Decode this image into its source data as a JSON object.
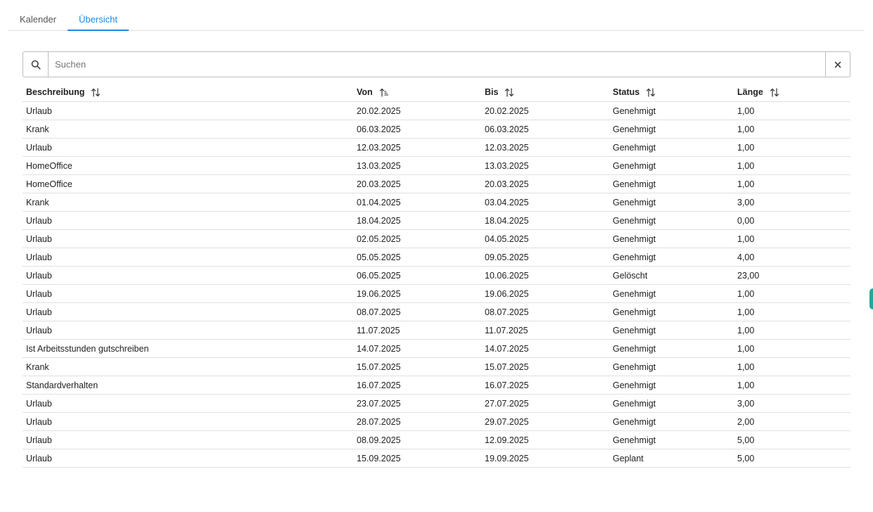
{
  "tabs": [
    {
      "label": "Kalender",
      "active": false
    },
    {
      "label": "Übersicht",
      "active": true
    }
  ],
  "search": {
    "placeholder": "Suchen",
    "value": "",
    "search_icon": "search-icon",
    "clear_icon": "close-icon"
  },
  "table": {
    "columns": [
      {
        "key": "beschreibung",
        "label": "Beschreibung",
        "sort": "none"
      },
      {
        "key": "von",
        "label": "Von",
        "sort": "ascending"
      },
      {
        "key": "bis",
        "label": "Bis",
        "sort": "none"
      },
      {
        "key": "status",
        "label": "Status",
        "sort": "none"
      },
      {
        "key": "laenge",
        "label": "Länge",
        "sort": "none"
      }
    ],
    "rows": [
      {
        "beschreibung": "Urlaub",
        "von": "20.02.2025",
        "bis": "20.02.2025",
        "status": "Genehmigt",
        "laenge": "1,00"
      },
      {
        "beschreibung": "Krank",
        "von": "06.03.2025",
        "bis": "06.03.2025",
        "status": "Genehmigt",
        "laenge": "1,00"
      },
      {
        "beschreibung": "Urlaub",
        "von": "12.03.2025",
        "bis": "12.03.2025",
        "status": "Genehmigt",
        "laenge": "1,00"
      },
      {
        "beschreibung": "HomeOffice",
        "von": "13.03.2025",
        "bis": "13.03.2025",
        "status": "Genehmigt",
        "laenge": "1,00"
      },
      {
        "beschreibung": "HomeOffice",
        "von": "20.03.2025",
        "bis": "20.03.2025",
        "status": "Genehmigt",
        "laenge": "1,00"
      },
      {
        "beschreibung": "Krank",
        "von": "01.04.2025",
        "bis": "03.04.2025",
        "status": "Genehmigt",
        "laenge": "3,00"
      },
      {
        "beschreibung": "Urlaub",
        "von": "18.04.2025",
        "bis": "18.04.2025",
        "status": "Genehmigt",
        "laenge": "0,00"
      },
      {
        "beschreibung": "Urlaub",
        "von": "02.05.2025",
        "bis": "04.05.2025",
        "status": "Genehmigt",
        "laenge": "1,00"
      },
      {
        "beschreibung": "Urlaub",
        "von": "05.05.2025",
        "bis": "09.05.2025",
        "status": "Genehmigt",
        "laenge": "4,00"
      },
      {
        "beschreibung": "Urlaub",
        "von": "06.05.2025",
        "bis": "10.06.2025",
        "status": "Gelöscht",
        "laenge": "23,00"
      },
      {
        "beschreibung": "Urlaub",
        "von": "19.06.2025",
        "bis": "19.06.2025",
        "status": "Genehmigt",
        "laenge": "1,00"
      },
      {
        "beschreibung": "Urlaub",
        "von": "08.07.2025",
        "bis": "08.07.2025",
        "status": "Genehmigt",
        "laenge": "1,00"
      },
      {
        "beschreibung": "Urlaub",
        "von": "11.07.2025",
        "bis": "11.07.2025",
        "status": "Genehmigt",
        "laenge": "1,00"
      },
      {
        "beschreibung": "Ist Arbeitsstunden gutschreiben",
        "von": "14.07.2025",
        "bis": "14.07.2025",
        "status": "Genehmigt",
        "laenge": "1,00"
      },
      {
        "beschreibung": "Krank",
        "von": "15.07.2025",
        "bis": "15.07.2025",
        "status": "Genehmigt",
        "laenge": "1,00"
      },
      {
        "beschreibung": "Standardverhalten",
        "von": "16.07.2025",
        "bis": "16.07.2025",
        "status": "Genehmigt",
        "laenge": "1,00"
      },
      {
        "beschreibung": "Urlaub",
        "von": "23.07.2025",
        "bis": "27.07.2025",
        "status": "Genehmigt",
        "laenge": "3,00"
      },
      {
        "beschreibung": "Urlaub",
        "von": "28.07.2025",
        "bis": "29.07.2025",
        "status": "Genehmigt",
        "laenge": "2,00"
      },
      {
        "beschreibung": "Urlaub",
        "von": "08.09.2025",
        "bis": "12.09.2025",
        "status": "Genehmigt",
        "laenge": "5,00"
      },
      {
        "beschreibung": "Urlaub",
        "von": "15.09.2025",
        "bis": "19.09.2025",
        "status": "Geplant",
        "laenge": "5,00"
      }
    ]
  },
  "colors": {
    "accent": "#1e88e5",
    "side_handle": "#26a69a",
    "border": "#e0e0e0"
  }
}
